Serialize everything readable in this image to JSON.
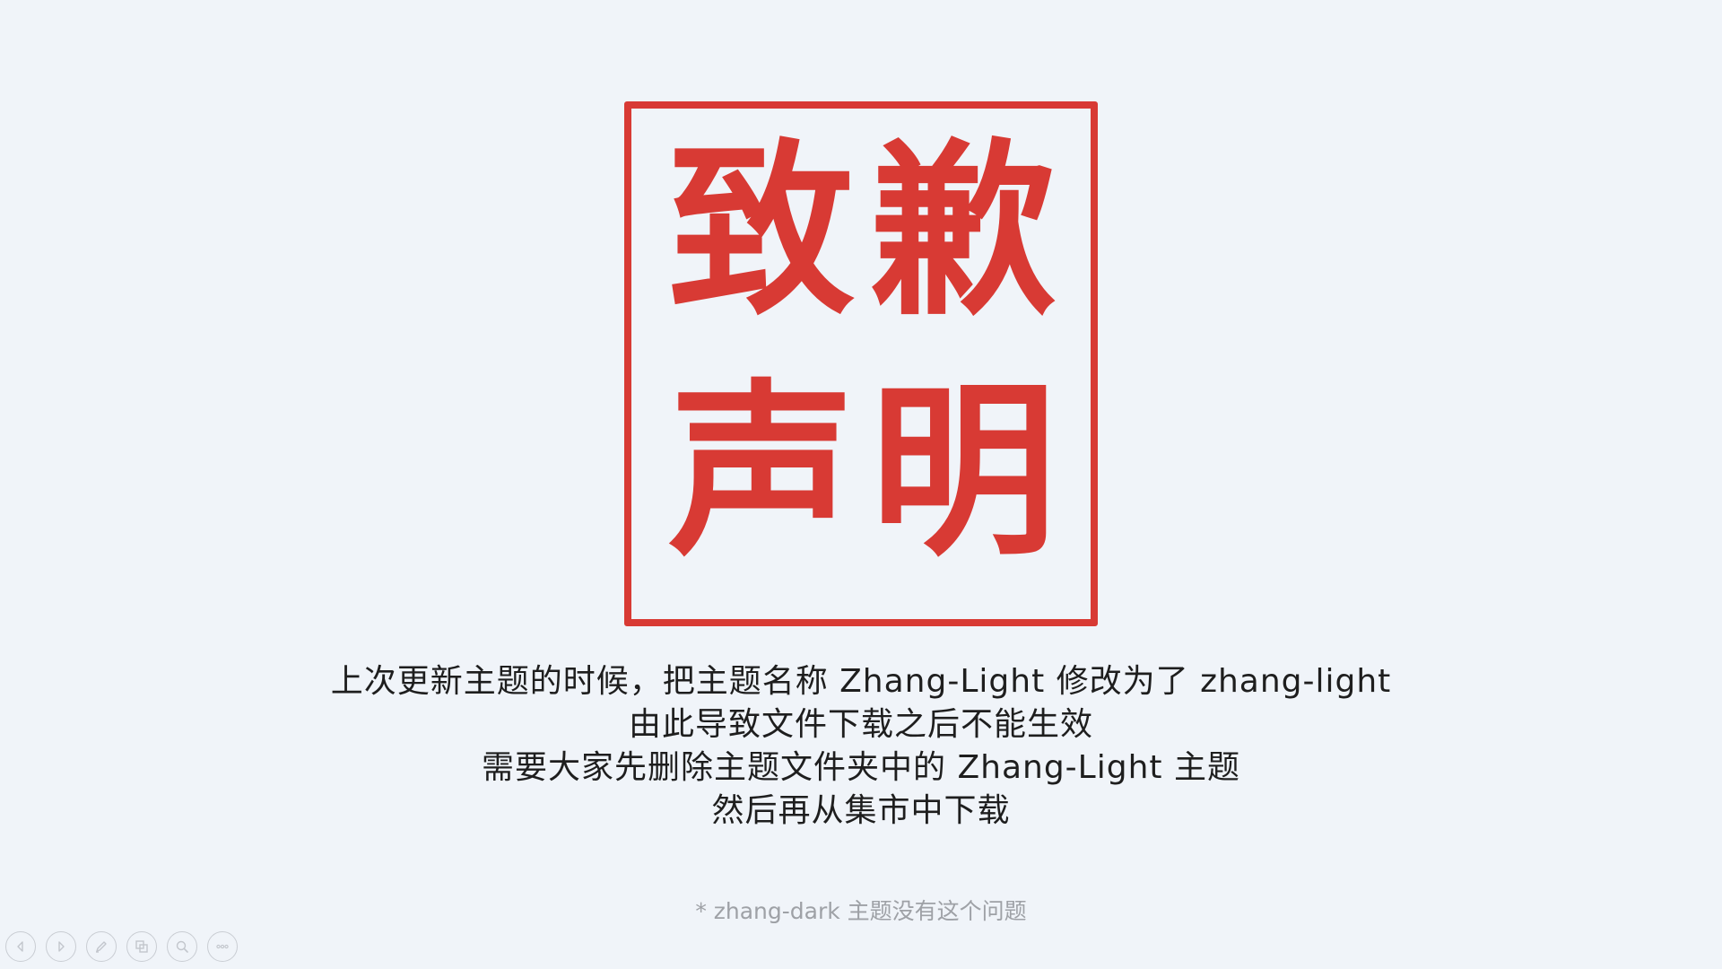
{
  "seal": {
    "characters": [
      "致",
      "歉",
      "声",
      "明"
    ],
    "color": "#d83a34"
  },
  "message": {
    "lines": [
      "上次更新主题的时候，把主题名称 Zhang-Light 修改为了 zhang-light",
      "由此导致文件下载之后不能生效",
      "需要大家先删除主题文件夹中的 Zhang-Light 主题",
      "然后再从集市中下载"
    ]
  },
  "footnote": "* zhang-dark 主题没有这个问题",
  "controls": [
    {
      "icon": "previous-icon"
    },
    {
      "icon": "next-icon"
    },
    {
      "icon": "pen-icon"
    },
    {
      "icon": "slides-overview-icon"
    },
    {
      "icon": "zoom-icon"
    },
    {
      "icon": "more-icon"
    }
  ],
  "colors": {
    "background": "#f0f4f9",
    "accent": "#d83a34",
    "text": "#1e1e1e",
    "muted": "#9ea1a6"
  }
}
